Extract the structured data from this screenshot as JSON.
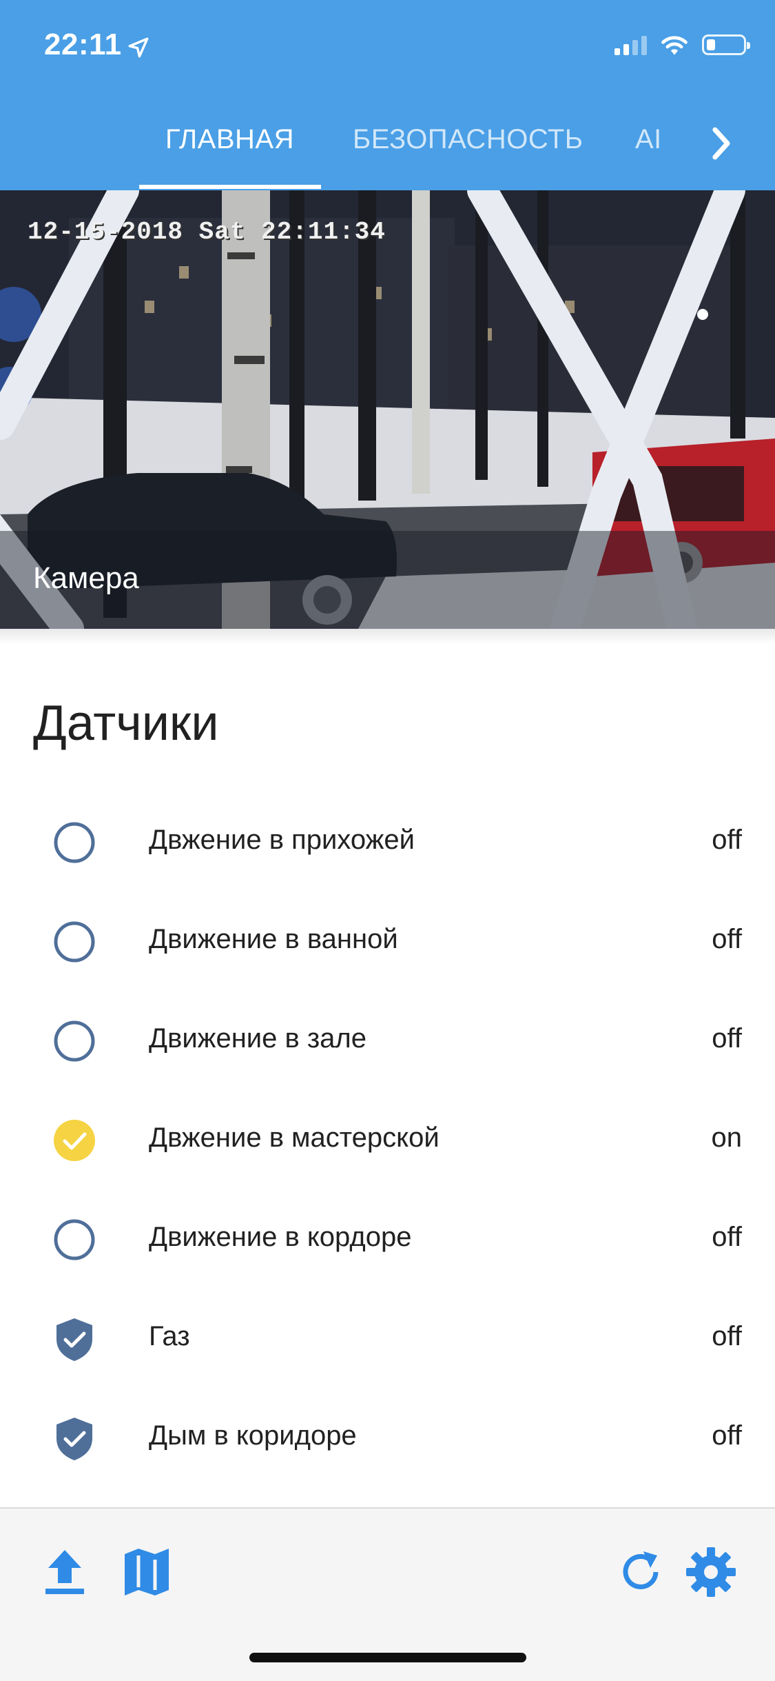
{
  "status_bar": {
    "time": "22:11"
  },
  "tabs": [
    {
      "label": "ГЛАВНАЯ",
      "active": true
    },
    {
      "label": "БЕЗОПАСНОСТЬ",
      "active": false
    },
    {
      "label": "AI",
      "active": false
    }
  ],
  "camera": {
    "timestamp": "12-15-2018 Sat 22:11:34",
    "caption": "Камера"
  },
  "sensors": {
    "title": "Датчики",
    "items": [
      {
        "label": "Двжение в прихожей",
        "state": "off",
        "icon": "radio-unchecked-icon"
      },
      {
        "label": "Движение в ванной",
        "state": "off",
        "icon": "radio-unchecked-icon"
      },
      {
        "label": "Движение в зале",
        "state": "off",
        "icon": "radio-unchecked-icon"
      },
      {
        "label": "Двжение в мастерской",
        "state": "on",
        "icon": "check-circle-icon"
      },
      {
        "label": "Движение в кордоре",
        "state": "off",
        "icon": "radio-unchecked-icon"
      },
      {
        "label": "Газ",
        "state": "off",
        "icon": "shield-check-icon"
      },
      {
        "label": "Дым в коридоре",
        "state": "off",
        "icon": "shield-check-icon"
      }
    ]
  },
  "colors": {
    "accent": "#4a9fe6",
    "icon_outline": "#4f6f99",
    "active_yellow": "#f5d342",
    "toolbar_icon": "#2f8be6"
  },
  "toolbar": {
    "left_icons": [
      "upload-icon",
      "map-icon"
    ],
    "right_icons": [
      "refresh-icon",
      "settings-gear-icon"
    ]
  }
}
